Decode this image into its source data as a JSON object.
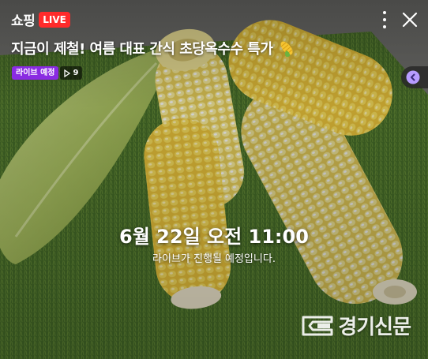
{
  "header": {
    "brand": "쇼핑",
    "live_badge": "LIVE"
  },
  "broadcast": {
    "title": "지금이 제철! 여름 대표 간식 초당옥수수 특가",
    "title_emoji": "corn-emoji-icon",
    "status_label": "라이브 예정",
    "view_count": "9"
  },
  "schedule": {
    "datetime": "6월 22일 오전 11:00",
    "notice": "라이브가 진행될 예정입니다."
  },
  "watermark": {
    "text": "경기신문"
  },
  "colors": {
    "live_red": "#ff2b2b",
    "status_purple": "#8a2be2",
    "side_accent": "#b79cff"
  }
}
